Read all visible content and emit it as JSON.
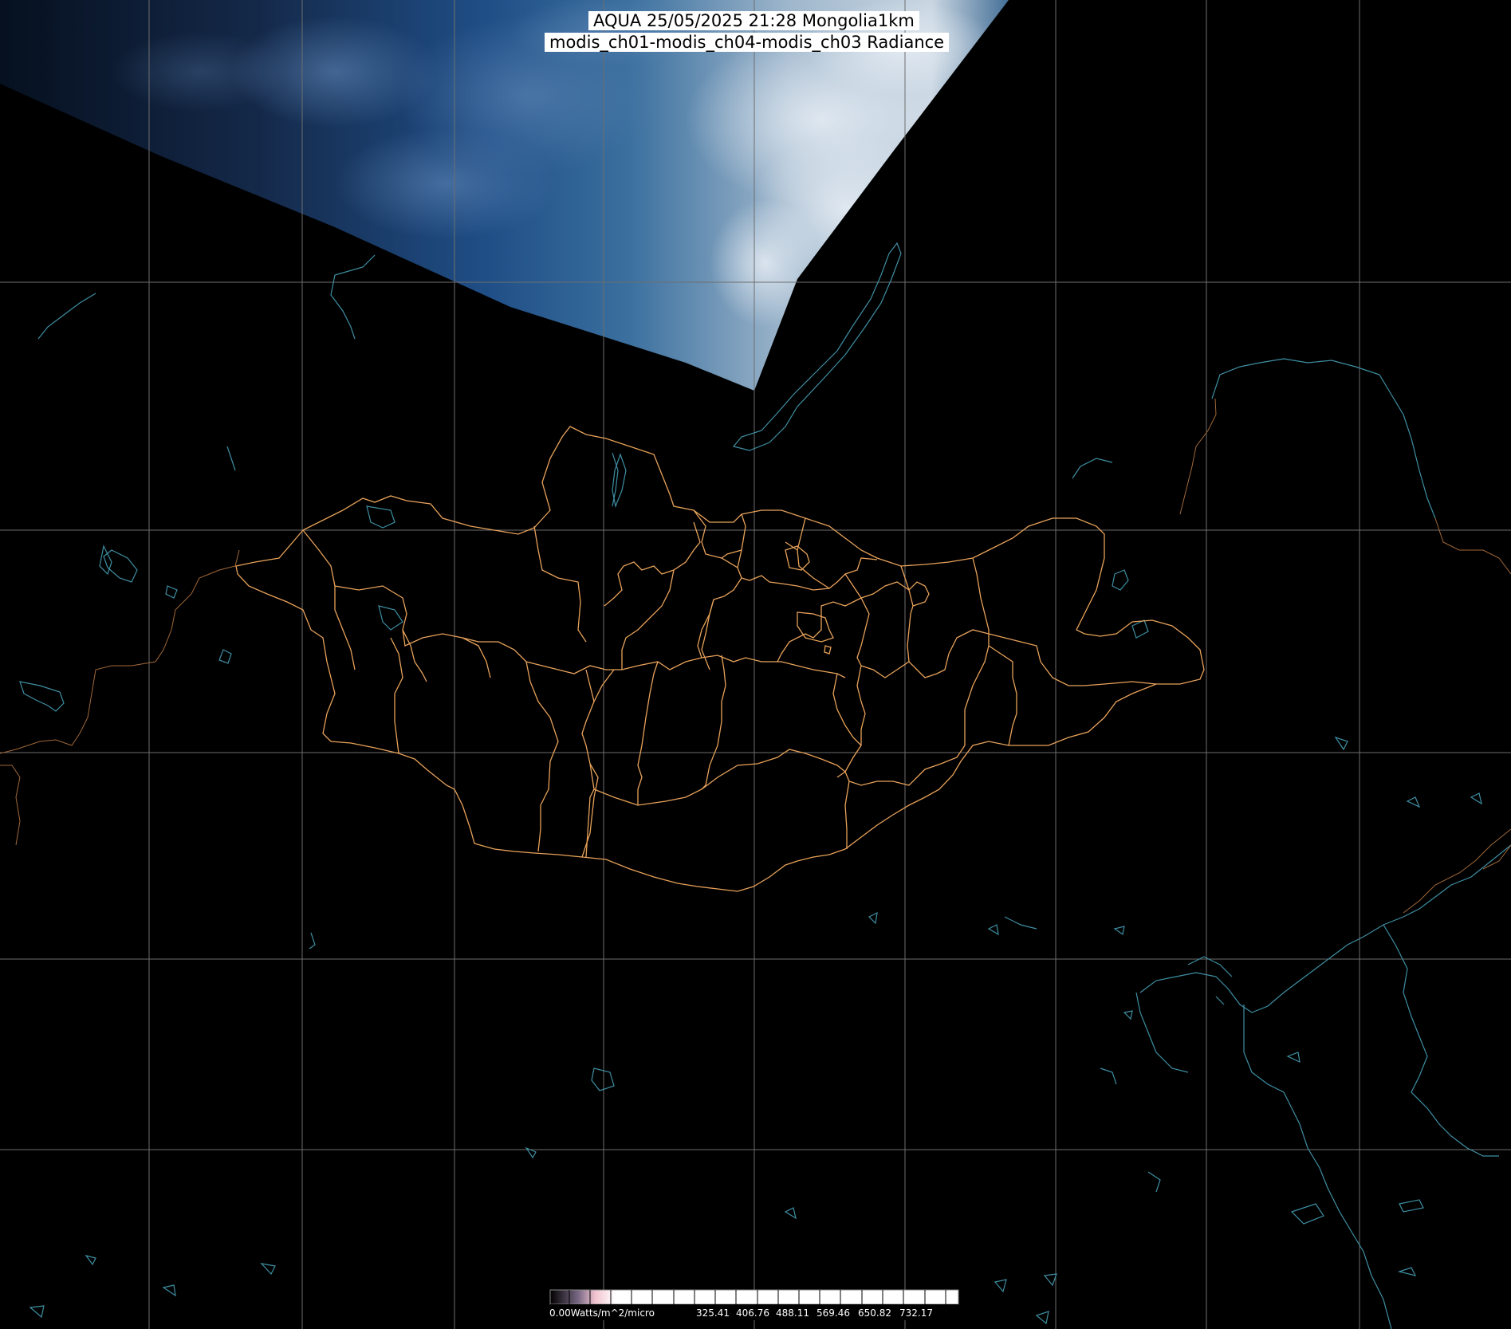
{
  "title": {
    "line1": "AQUA 25/05/2025 21:28 Mongolia1km",
    "line2": "modis_ch01-modis_ch04-modis_ch03 Radiance"
  },
  "colors": {
    "background": "#000000",
    "grid": "#6e6e6e",
    "province_borders": "#e8a25a",
    "coastlines": "#3e8fa3",
    "title_bg": "#ffffff"
  },
  "layers": {
    "satellite_swath": "true-color MODIS swath (cloud cover, blue tones)",
    "grid": "lat/lon graticule",
    "borders": "Mongolia aimag borders",
    "coastlines": "lakes, rivers and coastlines"
  },
  "legend": {
    "unit_label": "0.00Watts/m^2/micro",
    "ticks": [
      "325.41",
      "406.76",
      "488.11",
      "569.46",
      "650.82",
      "732.17"
    ]
  }
}
